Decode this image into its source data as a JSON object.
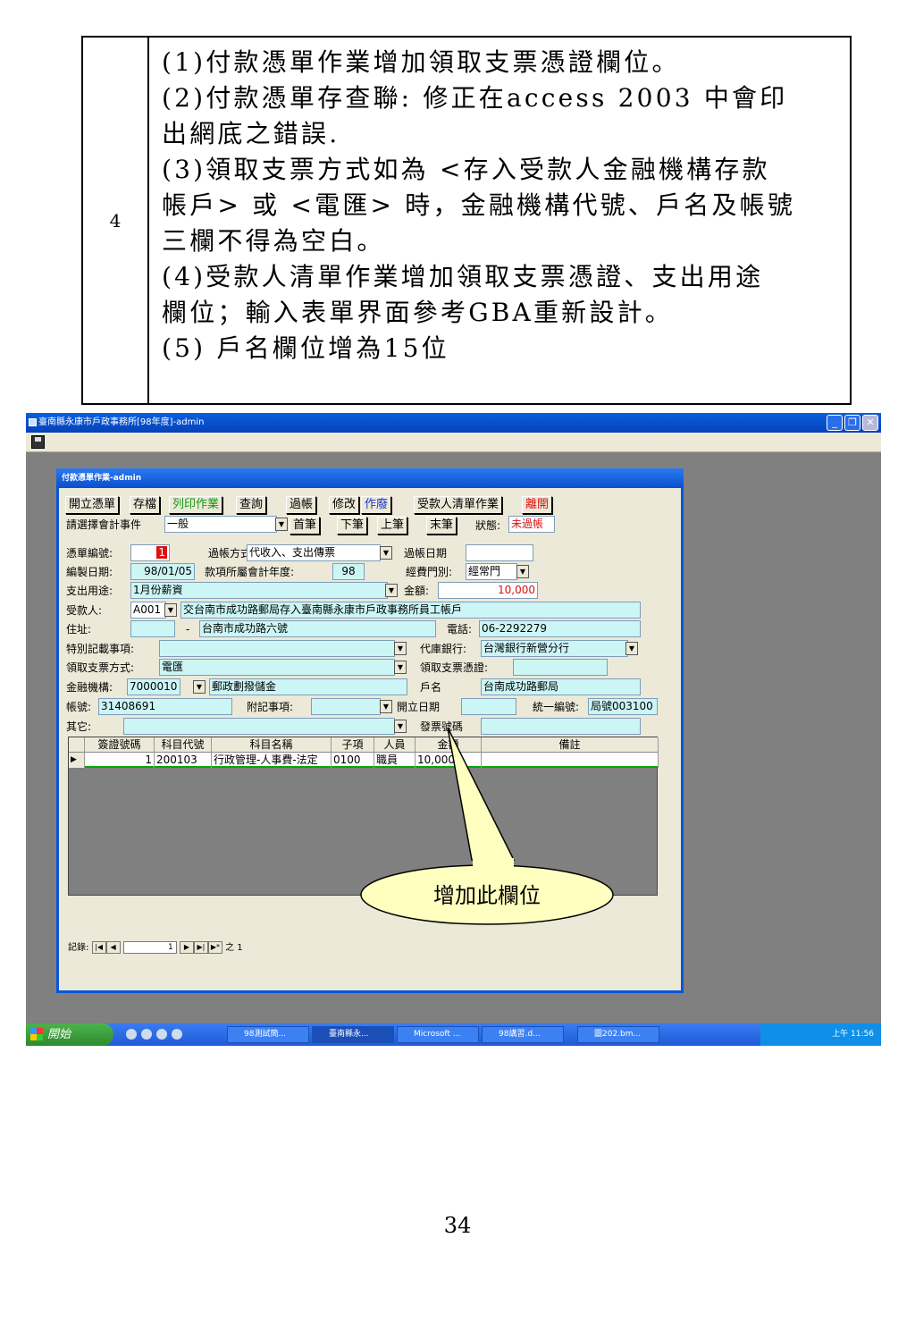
{
  "doc": {
    "row_number": "4",
    "lines": [
      "(1)付款憑單作業增加領取支票憑證欄位。",
      "(2)付款憑單存查聯: 修正在access 2003 中會印",
      "出網底之錯誤.",
      "(3)領取支票方式如為 <存入受款人金融機構存款",
      "帳戶> 或 <電匯> 時，金融機構代號、戶名及帳號",
      "三欄不得為空白。",
      "(4)受款人清單作業增加領取支票憑證、支出用途",
      "欄位；輸入表單界面參考GBA重新設計。",
      "(5) 戶名欄位增為15位"
    ],
    "page_number": "34"
  },
  "app": {
    "title": "臺南縣永康市戶政事務所[98年度]-admin",
    "form_title": "付款憑單作業-admin"
  },
  "toolbar": {
    "new": "開立憑單",
    "save": "存檔",
    "print": "列印作業",
    "query": "查詢",
    "post": "過帳",
    "edit": "修改",
    "void": "作廢",
    "payee_list": "受款人清單作業",
    "exit": "離開"
  },
  "nav": {
    "event_label": "請選擇會計事件",
    "event_value": "一般",
    "first": "首筆",
    "next": "下筆",
    "prev": "上筆",
    "last": "末筆",
    "status_label": "狀態:",
    "status_value": "未過帳"
  },
  "form": {
    "voucher_no_label": "憑單編號:",
    "voucher_no": "1",
    "post_method_label": "過帳方式:",
    "post_method": "代收入、支出傳票",
    "post_date_label": "過帳日期",
    "post_date": "",
    "prep_date_label": "編製日期:",
    "prep_date": "98/01/05",
    "fiscal_year_label": "款項所屬會計年度:",
    "fiscal_year": "98",
    "fund_type_label": "經費門別:",
    "fund_type": "經常門",
    "purpose_label": "支出用途:",
    "purpose": "1月份薪資",
    "amount_label": "金額:",
    "amount": "10,000",
    "payee_label": "受款人:",
    "payee_code": "A001",
    "payee_name": "交台南市成功路郵局存入臺南縣永康市戶政事務所員工帳戶",
    "address_label": "住址:",
    "zip": "",
    "zip_sep": "-",
    "address": "台南市成功路六號",
    "phone_label": "電話:",
    "phone": "06-2292279",
    "special_label": "特別記載事項:",
    "special": "",
    "treasury_label": "代庫銀行:",
    "treasury": "台灣銀行新營分行",
    "receive_method_label": "領取支票方式:",
    "receive_method": "電匯",
    "receive_voucher_label": "領取支票憑證:",
    "receive_voucher": "",
    "bank_label": "金融機構:",
    "bank_code": "7000010",
    "bank_name": "郵政劃撥儲金",
    "account_name_label": "戶名",
    "account_name": "台南成功路郵局",
    "account_no_label": "帳號:",
    "account_no": "31408691",
    "note_label": "附記事項:",
    "note": "",
    "open_date_label": "開立日期",
    "open_date": "",
    "tax_id_label": "統一編號:",
    "tax_id": "局號003100",
    "other_label": "其它:",
    "other": "",
    "invoice_label": "發票號碼",
    "invoice": ""
  },
  "grid": {
    "headers": [
      "簽證號碼",
      "科目代號",
      "科目名稱",
      "子項",
      "人員",
      "金額",
      "備註"
    ],
    "rows": [
      [
        "1",
        "200103",
        "行政管理-人事費-法定",
        "0100",
        "職員",
        "10,000",
        ""
      ]
    ],
    "record_label": "記錄:",
    "record_current": "1",
    "record_of": "之 1"
  },
  "callout": {
    "text": "增加此欄位"
  },
  "taskbar": {
    "start": "開始",
    "tasks": [
      "98測試簡...",
      "臺南縣永...",
      "Microsoft ...",
      "98講習.d...",
      "圖202.bm..."
    ],
    "clock": "上午 11:56"
  },
  "colors": {
    "title_blue": "#0a54d8",
    "field_bg": "#ccf5f5",
    "callout_fill": "#ffffc0"
  }
}
